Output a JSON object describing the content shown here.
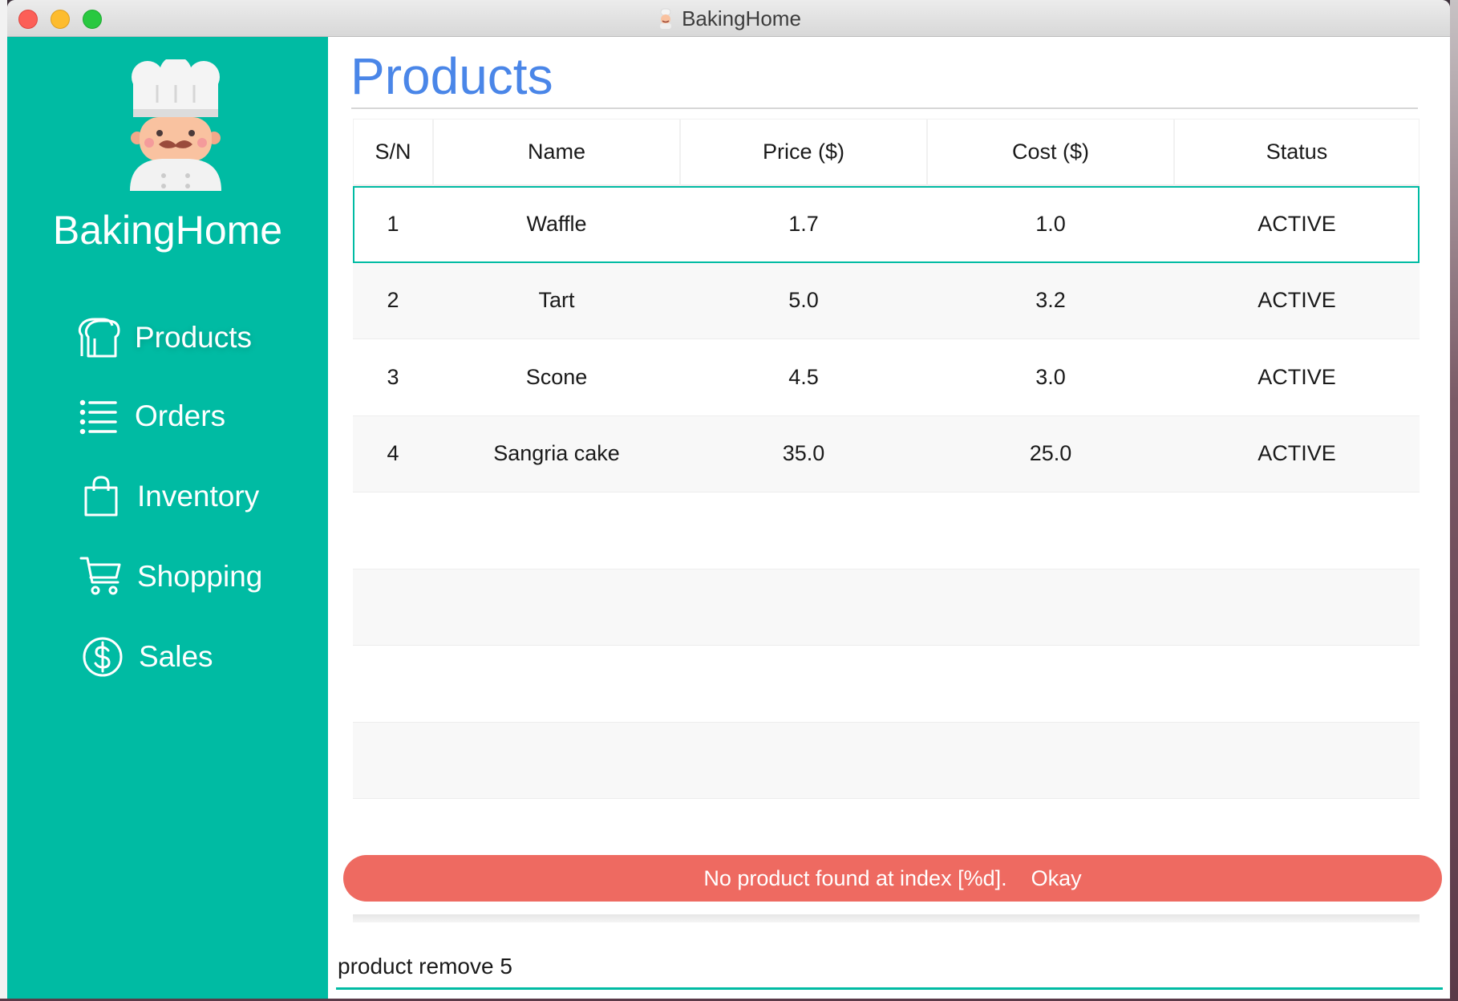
{
  "window": {
    "title": "BakingHome"
  },
  "sidebar": {
    "brand": "BakingHome",
    "items": [
      {
        "label": "Products",
        "icon": "bread-icon"
      },
      {
        "label": "Orders",
        "icon": "list-icon"
      },
      {
        "label": "Inventory",
        "icon": "bag-icon"
      },
      {
        "label": "Shopping",
        "icon": "cart-icon"
      },
      {
        "label": "Sales",
        "icon": "dollar-icon"
      }
    ]
  },
  "main": {
    "title": "Products",
    "table": {
      "columns": [
        "S/N",
        "Name",
        "Price ($)",
        "Cost ($)",
        "Status"
      ],
      "rows": [
        [
          "1",
          "Waffle",
          "1.7",
          "1.0",
          "ACTIVE"
        ],
        [
          "2",
          "Tart",
          "5.0",
          "3.2",
          "ACTIVE"
        ],
        [
          "3",
          "Scone",
          "4.5",
          "3.0",
          "ACTIVE"
        ],
        [
          "4",
          "Sangria cake",
          "35.0",
          "25.0",
          "ACTIVE"
        ]
      ],
      "selected_row": 0
    },
    "toast": {
      "message": "No product found at index [%d].",
      "action": "Okay"
    },
    "command_input": {
      "value": "product remove 5"
    }
  },
  "colors": {
    "sidebar": "#00bba3",
    "title": "#4a86e8",
    "toast": "#ee6a61",
    "accent": "#00bba3"
  }
}
